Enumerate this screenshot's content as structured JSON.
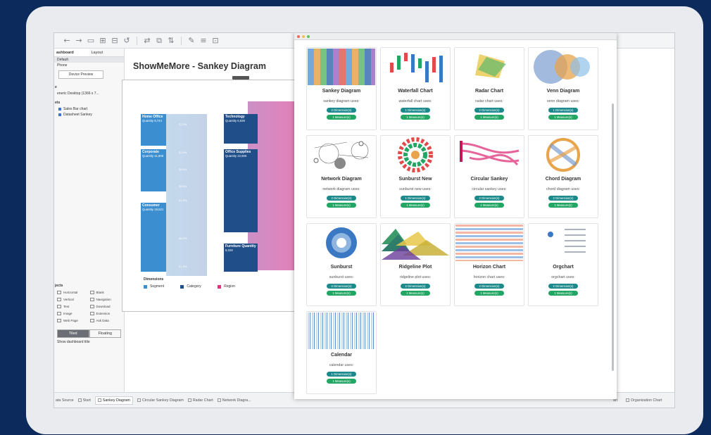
{
  "toolbar": {
    "icons": [
      "arrow-left",
      "arrow-right",
      "save",
      "add-datasource",
      "new-sheet",
      "undo",
      "redo",
      "swap",
      "sort",
      "highlight",
      "label",
      "fit",
      "present"
    ]
  },
  "left_pane": {
    "tabs": [
      "ashboard",
      "Layout"
    ],
    "device_default": "Default",
    "device_phone": "Phone",
    "device_preview_button": "Device Preview",
    "size_header": "e",
    "size_value": "eneric Desktop (1366 x 7...",
    "sheets_header": "ets",
    "sheets": [
      "Sales Bar chart",
      "Datasheet Sankey"
    ],
    "objects_header": "jects",
    "objects": [
      "Horizontal",
      "Blank",
      "Vertical",
      "Navigation",
      "Text",
      "Download",
      "Image",
      "Extension",
      "Web Page",
      "Ask Data"
    ],
    "tiled": "Tiled",
    "floating": "Floating",
    "show_title": "Show dashboard title"
  },
  "dashboard": {
    "title": "ShowMeMore - Sankey Diagram",
    "nodes": {
      "home_office": {
        "name": "Home    Office",
        "qty": "Quantity 8,744"
      },
      "corporate": {
        "name": "Corporate",
        "qty": "Quantity 11,608"
      },
      "consumer": {
        "name": "Consumer",
        "qty": "Quantity 19,521"
      },
      "technology": {
        "name": "Technology",
        "qty": "Quantity 6,939"
      },
      "office_supplies": {
        "name": "Office    Supplies",
        "qty": "Quantity 22,906"
      },
      "furniture": {
        "name": "Furniture  Quantity",
        "qty": "8,028"
      }
    },
    "pcts": [
      "21.2%",
      "31.4%",
      "38.4%",
      "38.5%",
      "21.3%",
      "46.2%",
      "57.1%",
      "21.3%"
    ],
    "legend": {
      "title": "Dimensions",
      "items": [
        "Segment",
        "Category",
        "Region"
      ],
      "colors": [
        "#3b8ed0",
        "#1f4e88",
        "#e0317a"
      ]
    }
  },
  "sheet_tabs": [
    "ata Source",
    "Start",
    "Sankey Diagram",
    "Circular Sankey Diagram",
    "Radar Chart",
    "Network Diagra...",
    "art",
    "Organization Chart"
  ],
  "gallery": {
    "dimension_label": "1 Dimension(s)",
    "measure_label": "1 Measure(s)",
    "two_dimension_label": "2 Dimension(s)",
    "cards": [
      {
        "name": "Sankey Diagram",
        "uses": "sankey diagram uses:",
        "dim": "2 Dimension(s)",
        "mea": "1 Measure(s)"
      },
      {
        "name": "Waterfall Chart",
        "uses": "waterfall chart uses:",
        "dim": "1 Dimension(s)",
        "mea": "1 Measure(s)"
      },
      {
        "name": "Radar Chart",
        "uses": "radar chart uses:",
        "dim": "2 Dimension(s)",
        "mea": "1 Measure(s)"
      },
      {
        "name": "Venn Diagram",
        "uses": "venn diagram uses:",
        "dim": "1 Dimension(s)",
        "mea": "1 Measure(s)"
      },
      {
        "name": "Network Diagram",
        "uses": "network diagram uses:",
        "dim": "2 Dimension(s)",
        "mea": "1 Measure(s)"
      },
      {
        "name": "Sunburst New",
        "uses": "sunburst new uses:",
        "dim": "1 Dimension(s)",
        "mea": "1 Measure(s)"
      },
      {
        "name": "Circular Sankey",
        "uses": "circular sankey uses:",
        "dim": "2 Dimension(s)",
        "mea": "1 Measure(s)"
      },
      {
        "name": "Chord Diagram",
        "uses": "chord diagram uses:",
        "dim": "2 Dimension(s)",
        "mea": "1 Measure(s)"
      },
      {
        "name": "Sunburst",
        "uses": "sunburst uses:",
        "dim": "2 Dimension(s)",
        "mea": "1 Measure(s)"
      },
      {
        "name": "Ridgeline Plot",
        "uses": "ridgeline plot uses:",
        "dim": "2 Dimension(s)",
        "mea": "1 Measure(s)"
      },
      {
        "name": "Horizon Chart",
        "uses": "horizon chart uses:",
        "dim": "2 Dimension(s)",
        "mea": "1 Measure(s)"
      },
      {
        "name": "Orgchart",
        "uses": "orgchart uses:",
        "dim": "2 Dimension(s)",
        "mea": "1 Measure(s)"
      },
      {
        "name": "Calendar",
        "uses": "calendar uses:",
        "dim": "1 Dimension(s)",
        "mea": "1 Measure(s)"
      }
    ]
  }
}
